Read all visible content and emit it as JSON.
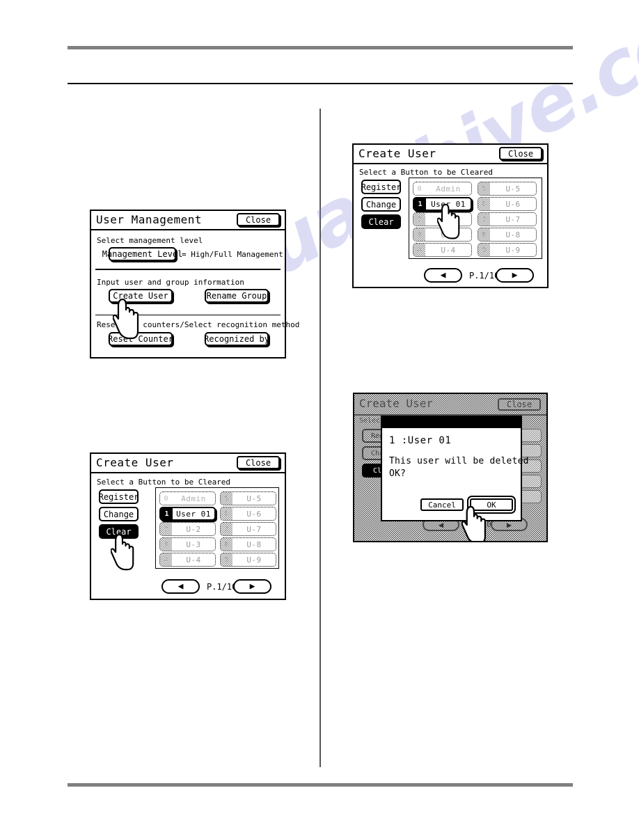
{
  "watermark": "manualshive.com",
  "panels": {
    "user_management": {
      "title": "User Management",
      "close_label": "Close",
      "section1_label": "Select management level",
      "management_level_button": "Management Level",
      "management_level_value": "= High/Full Management",
      "section2_label": "Input user and group information",
      "create_user_button": "Create User",
      "rename_group_button": "Rename Group",
      "section3_label": "Reset all counters/Select recognition method",
      "reset_counter_button": "Reset Counter",
      "recognized_by_button": "Recognized by"
    },
    "create_user_1": {
      "title": "Create User",
      "close_label": "Close",
      "subtitle": "Select a Button to be Cleared",
      "side_buttons": [
        {
          "label": "Register",
          "selected": false
        },
        {
          "label": "Change",
          "selected": false
        },
        {
          "label": "Clear",
          "selected": true
        }
      ],
      "users_left": [
        {
          "index": "0",
          "label": "Admin",
          "active": false,
          "admin": true
        },
        {
          "index": "1",
          "label": "User 01",
          "active": true,
          "admin": false
        },
        {
          "index": "2",
          "label": "U-2",
          "active": false,
          "admin": false
        },
        {
          "index": "3",
          "label": "U-3",
          "active": false,
          "admin": false
        },
        {
          "index": "4",
          "label": "U-4",
          "active": false,
          "admin": false
        }
      ],
      "users_right": [
        {
          "index": "5",
          "label": "U-5",
          "active": false,
          "admin": false
        },
        {
          "index": "6",
          "label": "U-6",
          "active": false,
          "admin": false
        },
        {
          "index": "7",
          "label": "U-7",
          "active": false,
          "admin": false
        },
        {
          "index": "8",
          "label": "U-8",
          "active": false,
          "admin": false
        },
        {
          "index": "9",
          "label": "U-9",
          "active": false,
          "admin": false
        }
      ],
      "prev_icon": "◀",
      "next_icon": "▶",
      "page_indicator": "P.1/10"
    },
    "create_user_2": {
      "title": "Create User",
      "close_label": "Close",
      "subtitle": "Select a Button to be Cleared",
      "side_buttons": [
        {
          "label": "Register",
          "selected": false
        },
        {
          "label": "Change",
          "selected": false
        },
        {
          "label": "Clear",
          "selected": true
        }
      ],
      "users_left": [
        {
          "index": "0",
          "label": "Admin",
          "active": false,
          "admin": true
        },
        {
          "index": "1",
          "label": "User 01",
          "active": true,
          "admin": false
        },
        {
          "index": "2",
          "label": "",
          "active": false,
          "admin": false
        },
        {
          "index": "3",
          "label": "U-3",
          "active": false,
          "admin": false
        },
        {
          "index": "4",
          "label": "U-4",
          "active": false,
          "admin": false
        }
      ],
      "users_right": [
        {
          "index": "5",
          "label": "U-5",
          "active": false,
          "admin": false
        },
        {
          "index": "6",
          "label": "U-6",
          "active": false,
          "admin": false
        },
        {
          "index": "7",
          "label": "U-7",
          "active": false,
          "admin": false
        },
        {
          "index": "8",
          "label": "U-8",
          "active": false,
          "admin": false
        },
        {
          "index": "9",
          "label": "U-9",
          "active": false,
          "admin": false
        }
      ],
      "prev_icon": "◀",
      "next_icon": "▶",
      "page_indicator": "P.1/10"
    },
    "confirm_dialog": {
      "background_title": "Create User",
      "background_close_label": "Close",
      "background_subtitle": "Select a Button to be Cleared",
      "background_side_buttons": [
        {
          "label": "Reg",
          "selected": false
        },
        {
          "label": "Cha",
          "selected": false
        },
        {
          "label": "Cl",
          "selected": true
        }
      ],
      "background_prev_icon": "◀",
      "background_next_icon": "▶",
      "background_page_indicator": "P.1/10",
      "user_line": "1 :User 01",
      "message_line1": "This user will be deleted",
      "message_line2": "OK?",
      "cancel_label": "Cancel",
      "ok_label": "OK"
    }
  }
}
